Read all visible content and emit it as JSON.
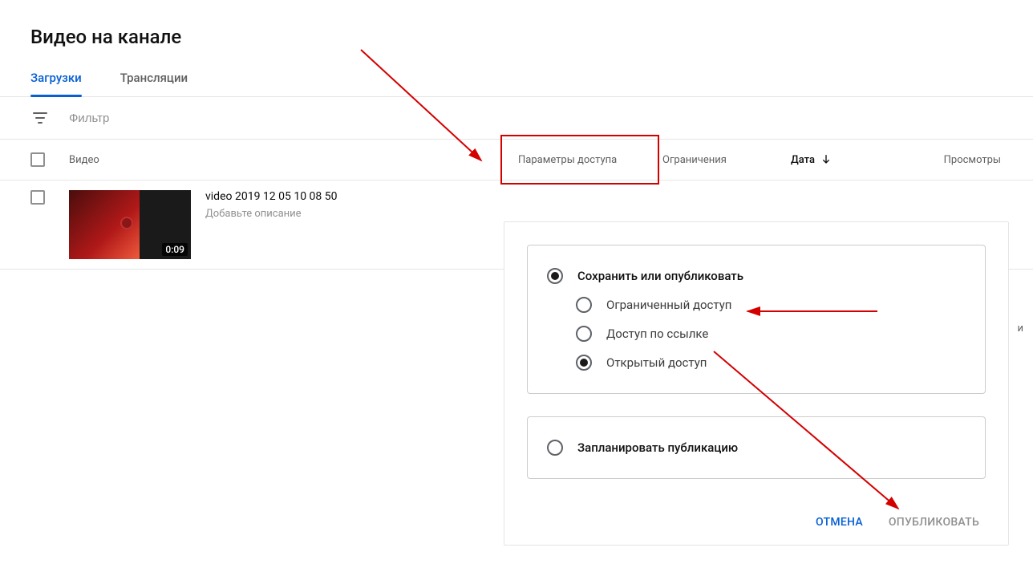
{
  "page_title": "Видео на канале",
  "tabs": {
    "uploads": "Загрузки",
    "live": "Трансляции",
    "active": "uploads"
  },
  "filter": {
    "placeholder": "Фильтр"
  },
  "columns": {
    "video": "Видео",
    "access": "Параметры доступа",
    "restrictions": "Ограничения",
    "date": "Дата",
    "views": "Просмотры"
  },
  "video_row": {
    "title": "video 2019 12 05 10 08 50",
    "description": "Добавьте описание",
    "duration": "0:09"
  },
  "popover": {
    "section1": {
      "title": "Сохранить или опубликовать",
      "options": [
        "Ограниченный доступ",
        "Доступ по ссылке",
        "Открытый доступ"
      ],
      "selected_main": true,
      "selected_sub_index": 2
    },
    "section2": {
      "title": "Запланировать публикацию",
      "selected": false
    },
    "cancel_label": "ОТМЕНА",
    "publish_label": "ОПУБЛИКОВАТЬ"
  },
  "footer_char": "и"
}
